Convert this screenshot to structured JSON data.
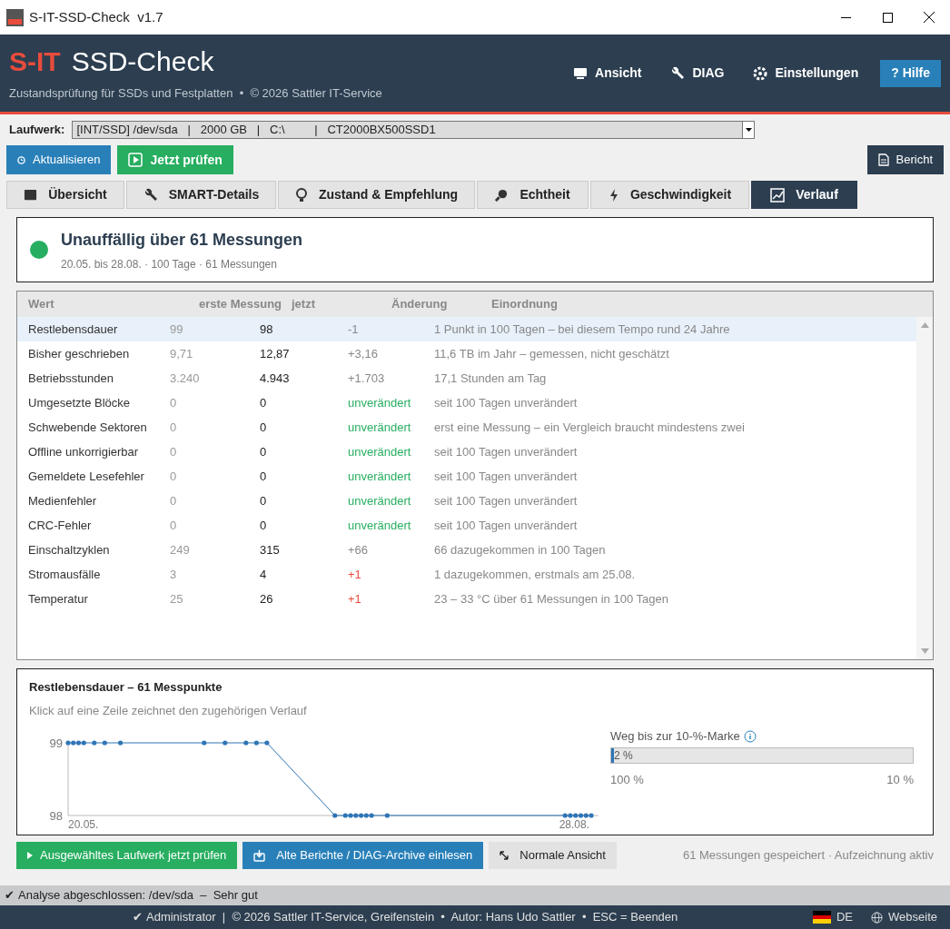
{
  "window": {
    "title": "S-IT-SSD-Check  v1.7"
  },
  "header": {
    "brand": "S-IT",
    "product": "SSD-Check",
    "subtitle": "Zustandsprüfung für SSDs und Festplatten  •  © 2026 Sattler IT-Service",
    "actions": [
      {
        "label": "Ansicht",
        "kind": "plain"
      },
      {
        "label": "DIAG",
        "kind": "plain"
      },
      {
        "label": "Einstellungen",
        "kind": "plain"
      },
      {
        "label": "? Hilfe",
        "kind": "primary"
      }
    ]
  },
  "drive": {
    "label": "Laufwerk:",
    "value": "[INT/SSD] /dev/sda   |   2000 GB   |   C:\\         |   CT2000BX500SSD1"
  },
  "toolbar": {
    "refresh": "Aktualisieren",
    "check": "Jetzt prüfen",
    "report": "Bericht"
  },
  "tabs": [
    {
      "label": "Übersicht",
      "selected": false
    },
    {
      "label": "SMART-Details",
      "selected": false
    },
    {
      "label": "Zustand & Empfehlung",
      "selected": false
    },
    {
      "label": "Echtheit",
      "selected": false
    },
    {
      "label": "Geschwindigkeit",
      "selected": false
    },
    {
      "label": "Verlauf",
      "selected": true
    }
  ],
  "summary": {
    "title": "Unauffällig über 61 Messungen",
    "detail": "20.05. bis 28.08. · 100 Tage · 61 Messungen",
    "color": "#27ae60"
  },
  "table": {
    "columns": [
      "Wert",
      "erste Messung",
      "jetzt",
      "Änderung",
      "Einordnung"
    ],
    "rows": [
      {
        "name": "Restlebensdauer",
        "first": "99",
        "now": "98",
        "change": "-1",
        "kind": "neutral",
        "note": "1 Punkt in 100 Tagen – bei diesem Tempo rund 24 Jahre",
        "selected": true
      },
      {
        "name": "Bisher geschrieben",
        "first": "9,71",
        "now": "12,87",
        "change": "+3,16",
        "kind": "neutral",
        "note": "11,6 TB im Jahr – gemessen, nicht geschätzt",
        "selected": false
      },
      {
        "name": "Betriebsstunden",
        "first": "3.240",
        "now": "4.943",
        "change": "+1.703",
        "kind": "neutral",
        "note": "17,1 Stunden am Tag",
        "selected": false
      },
      {
        "name": "Umgesetzte Blöcke",
        "first": "0",
        "now": "0",
        "change": "unverändert",
        "kind": "stable",
        "note": "seit 100 Tagen unverändert",
        "selected": false
      },
      {
        "name": "Schwebende Sektoren",
        "first": "0",
        "now": "0",
        "change": "unverändert",
        "kind": "stable",
        "note": "erst eine Messung – ein Vergleich braucht mindestens zwei",
        "selected": false
      },
      {
        "name": "Offline unkorrigierbar",
        "first": "0",
        "now": "0",
        "change": "unverändert",
        "kind": "stable",
        "note": "seit 100 Tagen unverändert",
        "selected": false
      },
      {
        "name": "Gemeldete Lesefehler",
        "first": "0",
        "now": "0",
        "change": "unverändert",
        "kind": "stable",
        "note": "seit 100 Tagen unverändert",
        "selected": false
      },
      {
        "name": "Medienfehler",
        "first": "0",
        "now": "0",
        "change": "unverändert",
        "kind": "stable",
        "note": "seit 100 Tagen unverändert",
        "selected": false
      },
      {
        "name": "CRC-Fehler",
        "first": "0",
        "now": "0",
        "change": "unverändert",
        "kind": "stable",
        "note": "seit 100 Tagen unverändert",
        "selected": false
      },
      {
        "name": "Einschaltzyklen",
        "first": "249",
        "now": "315",
        "change": "+66",
        "kind": "neutral",
        "note": "66 dazugekommen in 100 Tagen",
        "selected": false
      },
      {
        "name": "Stromausfälle",
        "first": "3",
        "now": "4",
        "change": "+1",
        "kind": "worse",
        "note": "1 dazugekommen, erstmals am 25.08.",
        "selected": false
      },
      {
        "name": "Temperatur",
        "first": "25",
        "now": "26",
        "change": "+1",
        "kind": "worse",
        "note": "23 – 33 °C über 61 Messungen in 100 Tagen",
        "selected": false
      }
    ]
  },
  "history": {
    "title": "Restlebensdauer – 61 Messpunkte",
    "hint": "Klick auf eine Zeile zeichnet den zugehörigen Verlauf",
    "chart_data": {
      "type": "line",
      "categories": [
        "20.05.",
        null,
        null,
        null,
        null,
        null,
        null,
        null,
        null,
        null,
        null,
        null,
        null,
        null,
        null,
        null,
        null,
        null,
        null,
        null,
        null,
        null,
        null,
        null,
        null,
        null,
        null,
        null,
        null,
        null,
        null,
        null,
        null,
        null,
        null,
        null,
        null,
        null,
        null,
        null,
        null,
        null,
        null,
        null,
        null,
        null,
        null,
        null,
        null,
        null,
        null,
        null,
        null,
        null,
        null,
        null,
        null,
        null,
        null,
        null,
        null,
        null,
        null,
        null,
        null,
        null,
        null,
        null,
        null,
        null,
        null,
        null,
        null,
        null,
        null,
        null,
        null,
        null,
        null,
        null,
        null,
        null,
        null,
        null,
        null,
        null,
        null,
        null,
        null,
        null,
        null,
        null,
        null,
        null,
        null,
        null,
        null,
        null,
        null,
        null,
        "28.08."
      ],
      "series": [
        {
          "color": "#2e75b6",
          "values": [
            99,
            99,
            99,
            99,
            null,
            99,
            null,
            99,
            null,
            null,
            99,
            null,
            null,
            null,
            null,
            null,
            null,
            null,
            null,
            null,
            null,
            null,
            null,
            null,
            null,
            null,
            99,
            null,
            null,
            null,
            99,
            null,
            null,
            null,
            99,
            null,
            99,
            null,
            99,
            null,
            null,
            null,
            null,
            null,
            null,
            null,
            null,
            null,
            null,
            null,
            null,
            98,
            null,
            98,
            98,
            98,
            98,
            98,
            98,
            null,
            null,
            98,
            null,
            null,
            null,
            null,
            null,
            null,
            null,
            null,
            null,
            null,
            null,
            null,
            null,
            null,
            null,
            null,
            null,
            null,
            null,
            null,
            null,
            null,
            null,
            null,
            null,
            null,
            null,
            null,
            null,
            null,
            null,
            null,
            null,
            98,
            98,
            98,
            98,
            98,
            98
          ]
        }
      ],
      "ylim": [
        98,
        99
      ],
      "yticks": [
        98,
        99
      ]
    },
    "progress": {
      "label": "Weg bis zur 10-%-Marke",
      "value": "2 %",
      "level": 0.01,
      "start": "100 %",
      "end": "10 %"
    }
  },
  "actions": {
    "check": "Ausgewähltes Laufwerk jetzt prüfen",
    "import": "Alte Berichte / DIAG-Archive einlesen",
    "normal": "Normale Ansicht",
    "status": "61 Messungen gespeichert · Aufzeichnung aktiv"
  },
  "status_bar": {
    "message_icon": "✔",
    "footer_icon": "✔",
    "message": "Analyse abgeschlossen: /dev/sda  –  Sehr gut",
    "footer": "Administrator  |  © 2026 Sattler IT-Service, Greifenstein  •  Autor: Hans Udo Sattler  •  ESC = Beenden",
    "language": "DE",
    "website": "Webseite"
  }
}
